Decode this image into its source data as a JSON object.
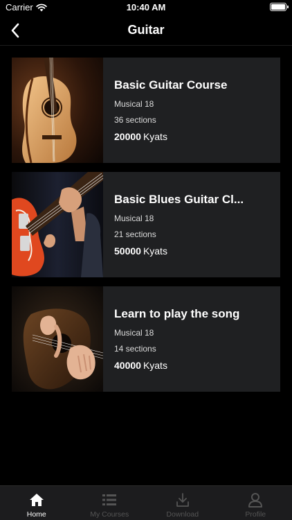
{
  "status_bar": {
    "carrier": "Carrier",
    "time": "10:40 AM"
  },
  "nav": {
    "title": "Guitar",
    "back_icon": "chevron-left-icon"
  },
  "courses": [
    {
      "title": "Basic Guitar Course",
      "meta1": "Musical 18",
      "meta2": "36 sections",
      "price": "20000",
      "currency": "Kyats"
    },
    {
      "title": "Basic Blues Guitar Cl...",
      "meta1": "Musical 18",
      "meta2": "21 sections",
      "price": "50000",
      "currency": "Kyats"
    },
    {
      "title": "Learn to play the song",
      "meta1": "Musical 18",
      "meta2": "14 sections",
      "price": "40000",
      "currency": "Kyats"
    }
  ],
  "tabs": [
    {
      "label": "Home",
      "icon": "home-icon",
      "active": true
    },
    {
      "label": "My Courses",
      "icon": "list-icon",
      "active": false
    },
    {
      "label": "Download",
      "icon": "download-icon",
      "active": false
    },
    {
      "label": "Profile",
      "icon": "profile-icon",
      "active": false
    }
  ],
  "colors": {
    "background": "#000000",
    "card": "#1f2022",
    "tabbar": "#1c1c1e",
    "inactive_tab": "#555555",
    "accent_orange": "#e0481f"
  }
}
